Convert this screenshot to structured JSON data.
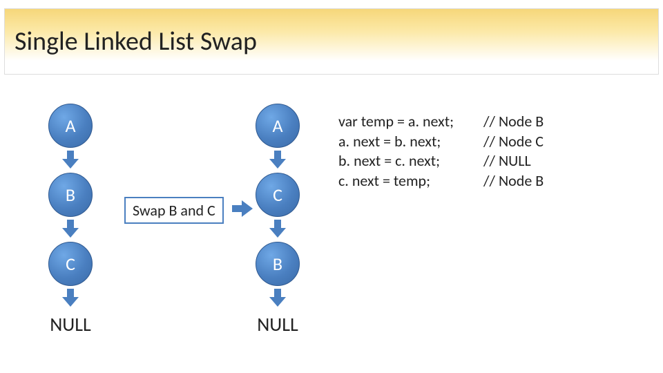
{
  "title": "Single Linked List Swap",
  "left_list": [
    "A",
    "B",
    "C"
  ],
  "right_list": [
    "A",
    "C",
    "B"
  ],
  "null_label": "NULL",
  "swap_label": "Swap B and C",
  "code": [
    {
      "stmt": "var temp = a. next;",
      "comment": "// Node B"
    },
    {
      "stmt": "a. next = b. next;",
      "comment": "// Node C"
    },
    {
      "stmt": "b. next = c. next;",
      "comment": "//  NULL"
    },
    {
      "stmt": "c. next = temp;",
      "comment": "// Node B"
    }
  ]
}
